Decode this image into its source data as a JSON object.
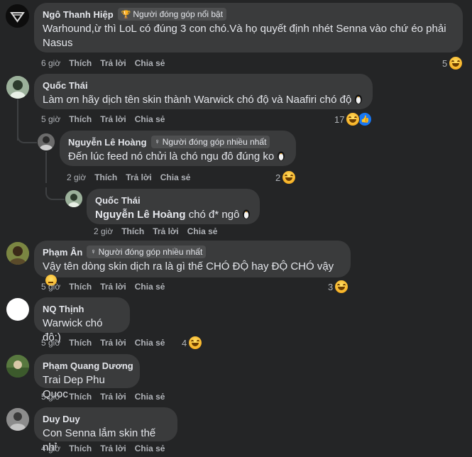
{
  "comments": [
    {
      "id": "c1",
      "author": "Ngô Thanh Hiệp",
      "badge": "Người đóng góp nổi bật",
      "badge_icon": "trophy-icon",
      "text": "Warhound,ừ thì LoL có đúng 3 con chó.Và họ quyết định nhét Senna vào chứ éo phải Nasus",
      "time": "6 giờ",
      "like": "Thích",
      "reply": "Trả lời",
      "share": "Chia sẻ",
      "reaction_count": "5",
      "reactions": [
        "haha"
      ]
    },
    {
      "id": "c2",
      "author": "Quốc Thái",
      "badge": "",
      "text": "Làm ơn hãy dịch tên skin thành Warwick chó độ và Naafiri chó độ",
      "time": "5 giờ",
      "like": "Thích",
      "reply": "Trả lời",
      "share": "Chia sẻ",
      "reaction_count": "17",
      "reactions": [
        "haha",
        "like"
      ]
    },
    {
      "id": "c3",
      "author": "Nguyễn Lê Hoàng",
      "badge": "Người đóng góp nhiều nhất",
      "badge_icon": "medal-icon",
      "text": "Đến lúc feed nó chửi là chó ngu đô đúng ko",
      "time": "2 giờ",
      "like": "Thích",
      "reply": "Trả lời",
      "share": "Chia sẻ",
      "reaction_count": "2",
      "reactions": [
        "haha"
      ]
    },
    {
      "id": "c4",
      "author": "Quốc Thái",
      "mention": "Nguyễn Lê Hoàng",
      "text": "chó đ* ngô",
      "time": "2 giờ",
      "like": "Thích",
      "reply": "Trả lời",
      "share": "Chia sẻ"
    },
    {
      "id": "c5",
      "author": "Phạm Ân",
      "badge": "Người đóng góp nhiều nhất",
      "badge_icon": "medal-icon",
      "text": "Vậy tên dòng skin dịch ra là gì thế CHÓ ĐỘ hay ĐỘ CHÓ vậy",
      "time": "5 giờ",
      "like": "Thích",
      "reply": "Trả lời",
      "share": "Chia sẻ",
      "reaction_count": "3",
      "reactions": [
        "haha"
      ]
    },
    {
      "id": "c6",
      "author": "NQ Thịnh",
      "text": "Warwick chó độ:)",
      "time": "5 giờ",
      "like": "Thích",
      "reply": "Trả lời",
      "share": "Chia sẻ",
      "reaction_count": "4",
      "reactions": [
        "haha"
      ]
    },
    {
      "id": "c7",
      "author": "Phạm Quang Dương",
      "text": "Trai Dep Phu Quoc",
      "time": "5 giờ",
      "like": "Thích",
      "reply": "Trả lời",
      "share": "Chia sẻ"
    },
    {
      "id": "c8",
      "author": "Duy Duy",
      "text": "Con Senna lắm skin thế nhỉ",
      "time": "4 giờ",
      "like": "Thích",
      "reply": "Trả lời",
      "share": "Chia sẻ"
    }
  ],
  "colors": {
    "background": "#242526",
    "bubble": "#3a3b3c",
    "text": "#e4e6eb",
    "muted": "#b0b3b8",
    "like_blue": "#1877f2",
    "haha_yellow": "#f7b125"
  }
}
